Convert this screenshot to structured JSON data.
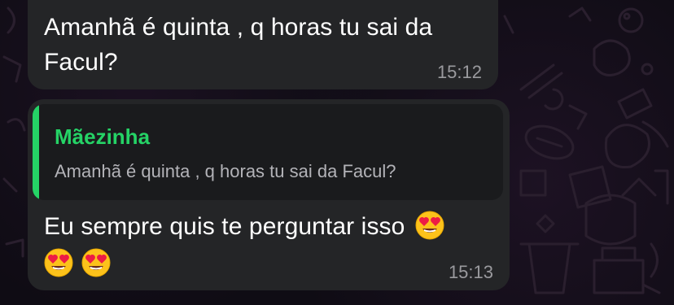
{
  "messages": [
    {
      "text_line1": "Amanhã é quinta , q horas tu sai da",
      "text_line2": "Facul?",
      "time": "15:12"
    },
    {
      "reply": {
        "author": "Mãezinha",
        "text": "Amanhã é quinta , q horas tu sai da Facul?"
      },
      "text": "Eu sempre quis te perguntar isso",
      "emojis": [
        "heart-eyes",
        "heart-eyes",
        "heart-eyes"
      ],
      "time": "15:13"
    }
  ],
  "colors": {
    "bubble": "#242527",
    "quote_bg": "#1a1b1d",
    "accent_green": "#25d366",
    "timestamp": "#9a9a9e",
    "background": "#0f0c14"
  }
}
